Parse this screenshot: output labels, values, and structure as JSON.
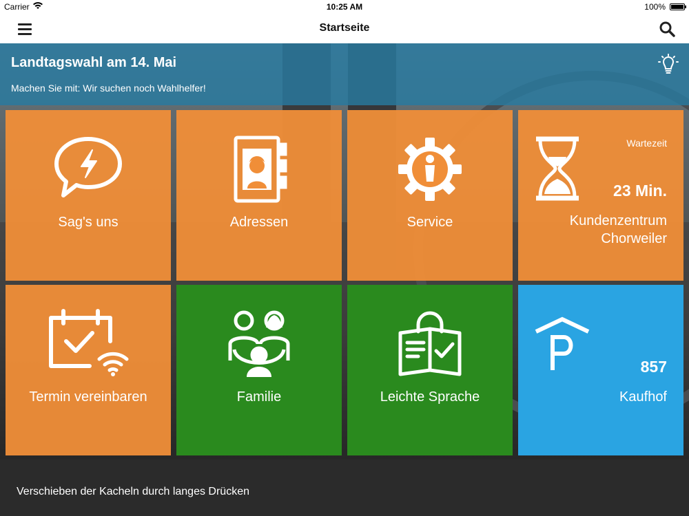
{
  "status_bar": {
    "carrier": "Carrier",
    "time": "10:25 AM",
    "battery": "100%"
  },
  "nav": {
    "title": "Startseite",
    "menu_icon": "hamburger-menu-icon",
    "search_icon": "search-icon"
  },
  "banner": {
    "title": "Landtagswahl am 14. Mai",
    "subtitle": "Machen Sie mit: Wir suchen noch Wahlhelfer!",
    "icon": "lightbulb-icon"
  },
  "tiles": [
    {
      "label": "Sag's uns",
      "icon": "speech-bubble-lightning-icon",
      "color": "#F08E38"
    },
    {
      "label": "Adressen",
      "icon": "address-book-icon",
      "color": "#F08E38"
    },
    {
      "label": "Service",
      "icon": "gear-person-icon",
      "color": "#F08E38"
    },
    {
      "label_line1": "Kundenzentrum",
      "label_line2": "Chorweiler",
      "wait_caption": "Wartezeit",
      "wait_value": "23 Min.",
      "icon": "hourglass-icon",
      "color": "#F08E38"
    },
    {
      "label": "Termin vereinbaren",
      "icon": "calendar-check-wifi-icon",
      "color": "#F08E38"
    },
    {
      "label": "Familie",
      "icon": "family-icon",
      "color": "#2A8A1E"
    },
    {
      "label": "Leichte Sprache",
      "icon": "open-book-check-icon",
      "color": "#2A8A1E"
    },
    {
      "label": "Kaufhof",
      "count": "857",
      "icon": "parking-icon",
      "color": "#2AA4E2"
    }
  ],
  "footer": {
    "hint": "Verschieben der Kacheln durch langes Drücken"
  }
}
